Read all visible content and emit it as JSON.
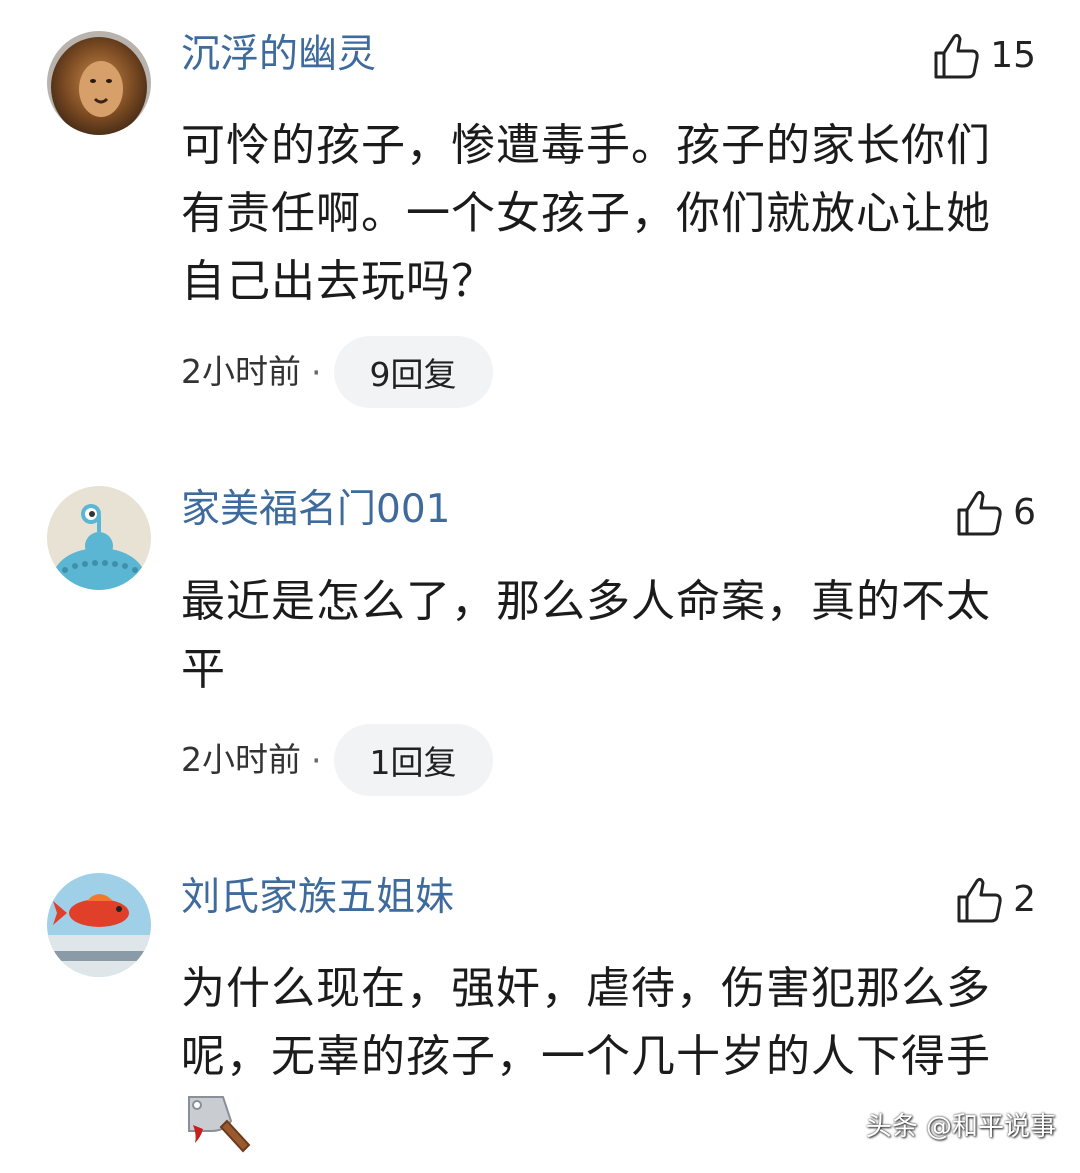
{
  "comments": [
    {
      "username": "沉浮的幽灵",
      "likes": "15",
      "content": "可怜的孩子，惨遭毒手。孩子的家长你们有责任啊。一个女孩子，你们就放心让她自己出去玩吗？",
      "time": "2小时前",
      "reply_label": "9回复",
      "avatar_icon": "lion-avatar"
    },
    {
      "username": "家美福名门001",
      "likes": "6",
      "content": "最近是怎么了，那么多人命案，真的不太平",
      "time": "2小时前",
      "reply_label": "1回复",
      "avatar_icon": "cartoon-alien-avatar"
    },
    {
      "username": "刘氏家族五姐妹",
      "likes": "2",
      "content": "为什么现在，强奸，虐待，伤害犯那么多呢，无辜的孩子，一个几十岁的人下得手",
      "emoji": "cleaver-emoji",
      "avatar_icon": "goldfish-avatar"
    }
  ],
  "watermark": "头条 @和平说事",
  "colors": {
    "username": "#3e6a9c",
    "reply_bg": "#f2f3f5",
    "text": "#1b1b1b"
  }
}
